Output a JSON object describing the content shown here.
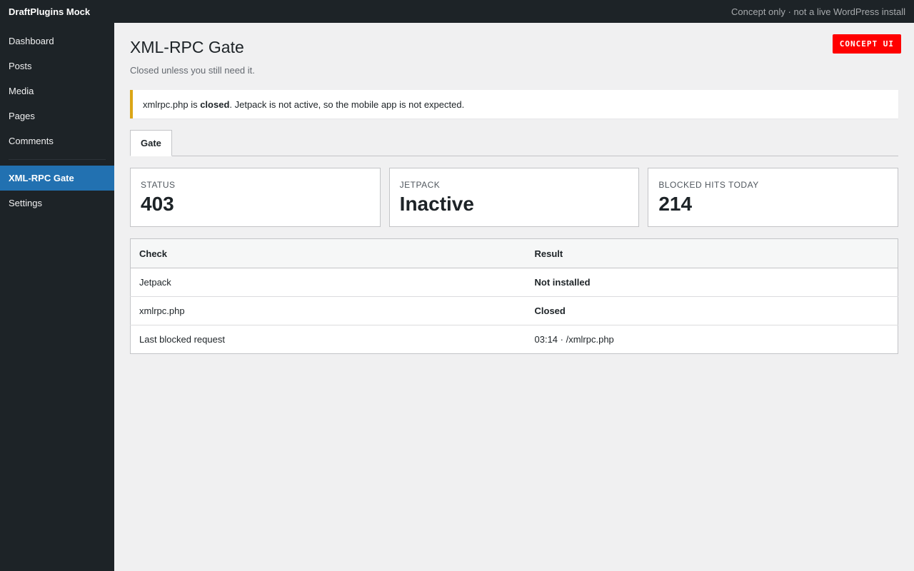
{
  "topbar": {
    "brand": "DraftPlugins Mock",
    "note": "Concept only · not a live WordPress install"
  },
  "sidebar": {
    "items": [
      {
        "label": "Dashboard"
      },
      {
        "label": "Posts"
      },
      {
        "label": "Media"
      },
      {
        "label": "Pages"
      },
      {
        "label": "Comments"
      }
    ],
    "plugin_items": [
      {
        "label": "XML-RPC Gate",
        "active": true
      },
      {
        "label": "Settings",
        "active": false
      }
    ]
  },
  "page": {
    "title": "XML-RPC Gate",
    "subtitle": "Closed unless you still need it.",
    "badge": "CONCEPT UI"
  },
  "notice": {
    "prefix": "xmlrpc.php is ",
    "strong": "closed",
    "suffix": ". Jetpack is not active, so the mobile app is not expected.",
    "border_color": "#dba617"
  },
  "tabs": [
    {
      "label": "Gate",
      "active": true
    }
  ],
  "cards": [
    {
      "label": "STATUS",
      "value": "403"
    },
    {
      "label": "JETPACK",
      "value": "Inactive"
    },
    {
      "label": "BLOCKED HITS TODAY",
      "value": "214"
    }
  ],
  "table": {
    "headers": {
      "check": "Check",
      "result": "Result"
    },
    "rows": [
      {
        "check": "Jetpack",
        "result": "Not installed",
        "status": "ok"
      },
      {
        "check": "xmlrpc.php",
        "result": "Closed",
        "status": "ok"
      },
      {
        "check": "Last blocked request",
        "result": "03:14 · /xmlrpc.php",
        "status": "plain"
      }
    ]
  },
  "colors": {
    "admin_bar": "#1d2327",
    "active_menu": "#2271b1",
    "badge": "#ff0000",
    "ok_text": "#00a32a"
  }
}
